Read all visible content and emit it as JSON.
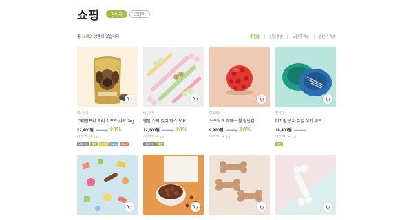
{
  "header": {
    "title": "쇼핑",
    "tabs": [
      {
        "label": "강아지",
        "active": true
      },
      {
        "label": "고양이",
        "active": false
      }
    ]
  },
  "summary": {
    "prefix": "총",
    "count": "16",
    "suffix": "개의 상품이 있습니다."
  },
  "sort": [
    {
      "label": "추천순",
      "active": true
    },
    {
      "label": "신상품순",
      "active": false
    },
    {
      "label": "낮은가격순",
      "active": false
    },
    {
      "label": "높은가격순",
      "active": false
    }
  ],
  "colors": {
    "accent": "#a9b94a",
    "star": "#f2b01e",
    "badge_gray": "#8a8a8a",
    "badge_green": "#a9b94a",
    "badge_yellow": "#e9c640",
    "badge_blue": "#6cb3e2",
    "badge_red": "#e77b73"
  },
  "products": [
    {
      "brand": "헬스네이",
      "name": "그레인프리 오리 소프트 사료 2kg",
      "price": "22,400원",
      "original_price": "28,000원",
      "discount": "20%",
      "reviews": "리뷰 32",
      "rating": "4.5",
      "badges": [
        {
          "label": "무료배송",
          "color": "#8a8a8a"
        },
        {
          "label": "추천",
          "color": "#a9b94a"
        },
        {
          "label": "BEST",
          "color": "#e9c640"
        },
        {
          "label": "NEW",
          "color": "#6cb3e2"
        },
        {
          "label": "SALE",
          "color": "#e77b73"
        }
      ]
    },
    {
      "brand": "바우와우",
      "name": "덴탈 스틱 컬러 믹스 30P",
      "price": "12,000원",
      "original_price": "15,000원",
      "discount": "20%",
      "reviews": "리뷰 63",
      "rating": "4.8",
      "badges": [
        {
          "label": "무료배송",
          "color": "#8a8a8a"
        },
        {
          "label": "추천",
          "color": "#a9b94a"
        }
      ]
    },
    {
      "brand": "펫플레이",
      "name": "노즈워크 라텍스 볼 장난감",
      "price": "9,900원",
      "original_price": "12,500원",
      "discount": "20%",
      "reviews": "리뷰 42",
      "rating": "4.8",
      "badges": []
    },
    {
      "brand": "펫키친",
      "name": "미끄럼 방지 듀얼 식기 세트",
      "price": "18,400원",
      "original_price": "23,000원",
      "discount": "",
      "reviews": "리뷰 34",
      "rating": "4.9",
      "badges": [
        {
          "label": "추천",
          "color": "#a9b94a"
        }
      ]
    }
  ]
}
